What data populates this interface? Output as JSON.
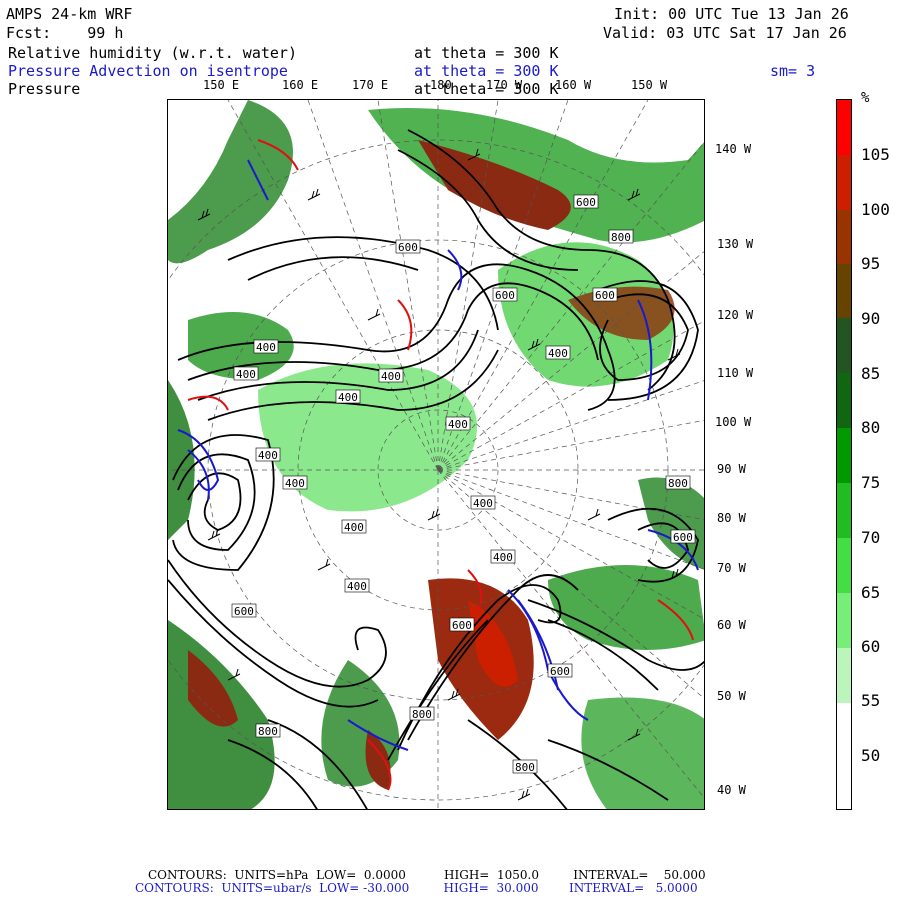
{
  "header": {
    "model": "AMPS 24-km WRF",
    "forecast": "Fcst:    99 h",
    "init": "Init: 00 UTC Tue 13 Jan 26",
    "valid": "Valid: 03 UTC Sat 17 Jan 26",
    "rows": [
      {
        "field": "Relative humidity (w.r.t. water)",
        "level": "at theta = 300 K",
        "extra": "",
        "color": "#000000"
      },
      {
        "field": "Pressure Advection on isentrope",
        "level": "at theta = 300 K",
        "extra": "sm= 3",
        "color": "#1a1acc"
      },
      {
        "field": "Pressure",
        "level": "at theta = 300 K",
        "extra": "",
        "color": "#000000"
      }
    ]
  },
  "longitude_labels_top": [
    "150 E",
    "160 E",
    "170 E",
    "180",
    "170 W",
    "160 W",
    "150 W"
  ],
  "longitude_labels_right": [
    "140 W",
    "130 W",
    "120 W",
    "110 W",
    "100 W",
    "90 W",
    "80 W",
    "70 W",
    "60 W",
    "50 W",
    "40 W"
  ],
  "pressure_contour_labels": [
    "600",
    "800",
    "800",
    "800",
    "600",
    "600",
    "400",
    "600",
    "400",
    "400",
    "400",
    "400",
    "400",
    "400",
    "400",
    "400",
    "400",
    "400",
    "400",
    "600",
    "600",
    "600",
    "800",
    "800",
    "600"
  ],
  "legend": {
    "unit": "%",
    "labels": [
      "105",
      "100",
      "95",
      "90",
      "85",
      "80",
      "75",
      "70",
      "65",
      "60",
      "55",
      "50"
    ],
    "colors": [
      "#ff0000",
      "#cc1f00",
      "#993300",
      "#664400",
      "#225522",
      "#116611",
      "#009900",
      "#22bb22",
      "#44dd44",
      "#77ee77",
      "#bbf5bb",
      "#ffffff"
    ]
  },
  "footer": {
    "line1": "CONTOURS:  UNITS=hPa  LOW=  0.0000          HIGH=  1050.0         INTERVAL=    50.000",
    "line2": "CONTOURS:  UNITS=ubar/s  LOW= -30.000         HIGH=  30.000        INTERVAL=   5.0000",
    "line1_color": "#000000",
    "line2_color": "#1a1acc"
  }
}
